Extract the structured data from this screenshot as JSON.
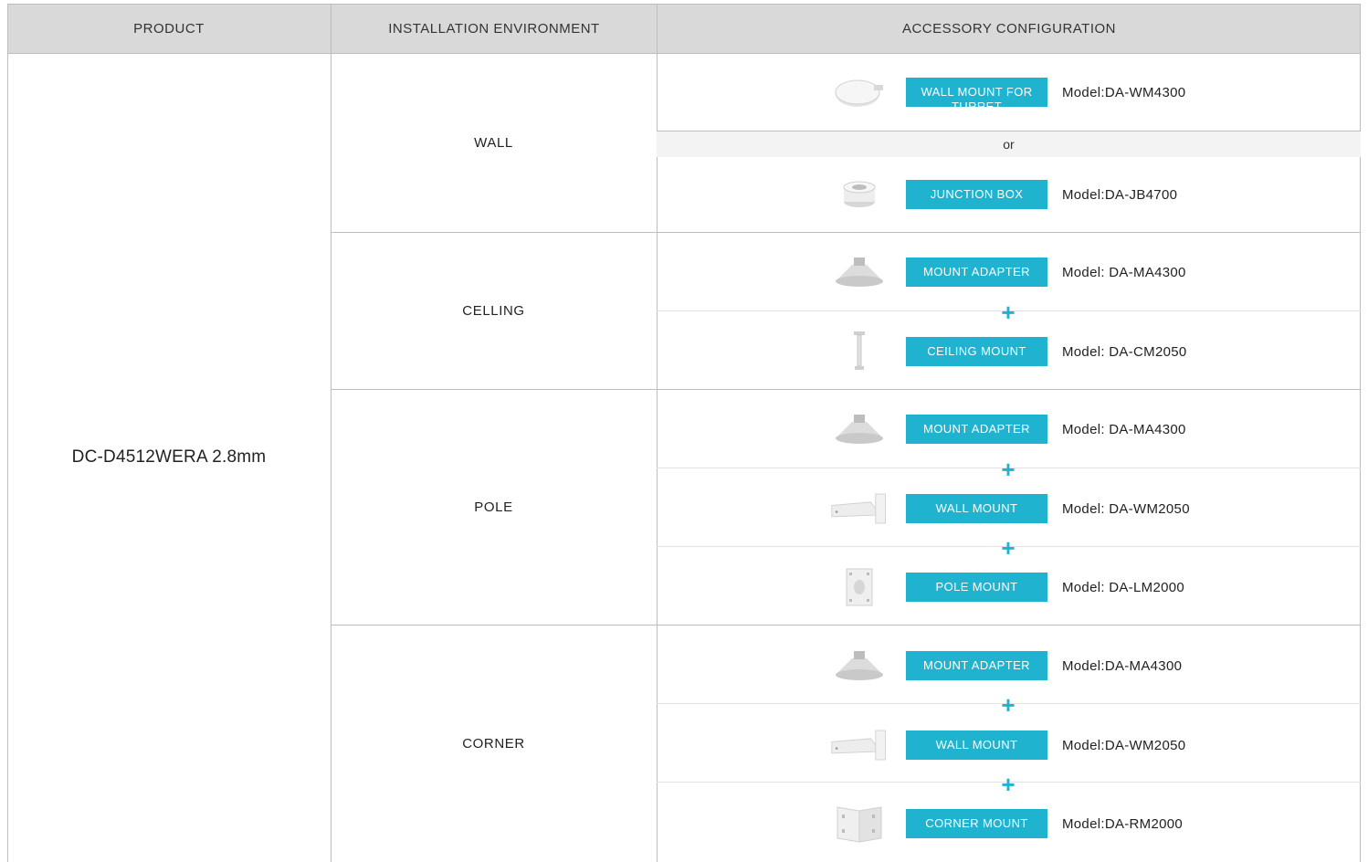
{
  "headers": {
    "product": "PRODUCT",
    "environment": "INSTALLATION ENVIRONMENT",
    "accessory": "ACCESSORY CONFIGURATION"
  },
  "product": "DC-D4512WERA 2.8mm",
  "environments": {
    "wall": "WALL",
    "ceiling": "CELLING",
    "pole": "POLE",
    "corner": "CORNER"
  },
  "or_label": "or",
  "plus_symbol": "+",
  "accent_color": "#1fb3cf",
  "accessories": {
    "wall_1": {
      "label": "WALL MOUNT FOR TURRET",
      "model": "Model:DA-WM4300",
      "icon": "round-plate-icon"
    },
    "wall_2": {
      "label": "JUNCTION BOX",
      "model": "Model:DA-JB4700",
      "icon": "junction-box-icon"
    },
    "ceiling_1": {
      "label": "MOUNT ADAPTER",
      "model": "Model: DA-MA4300",
      "icon": "mount-adapter-icon"
    },
    "ceiling_2": {
      "label": "CEILING MOUNT",
      "model": "Model: DA-CM2050",
      "icon": "ceiling-pole-icon"
    },
    "pole_1": {
      "label": "MOUNT ADAPTER",
      "model": "Model: DA-MA4300",
      "icon": "mount-adapter-icon"
    },
    "pole_2": {
      "label": "WALL MOUNT",
      "model": "Model: DA-WM2050",
      "icon": "wall-bracket-icon"
    },
    "pole_3": {
      "label": "POLE MOUNT",
      "model": "Model: DA-LM2000",
      "icon": "pole-plate-icon"
    },
    "corner_1": {
      "label": "MOUNT ADAPTER",
      "model": "Model:DA-MA4300",
      "icon": "mount-adapter-icon"
    },
    "corner_2": {
      "label": "WALL MOUNT",
      "model": "Model:DA-WM2050",
      "icon": "wall-bracket-icon"
    },
    "corner_3": {
      "label": "CORNER MOUNT",
      "model": "Model:DA-RM2000",
      "icon": "corner-plate-icon"
    }
  }
}
